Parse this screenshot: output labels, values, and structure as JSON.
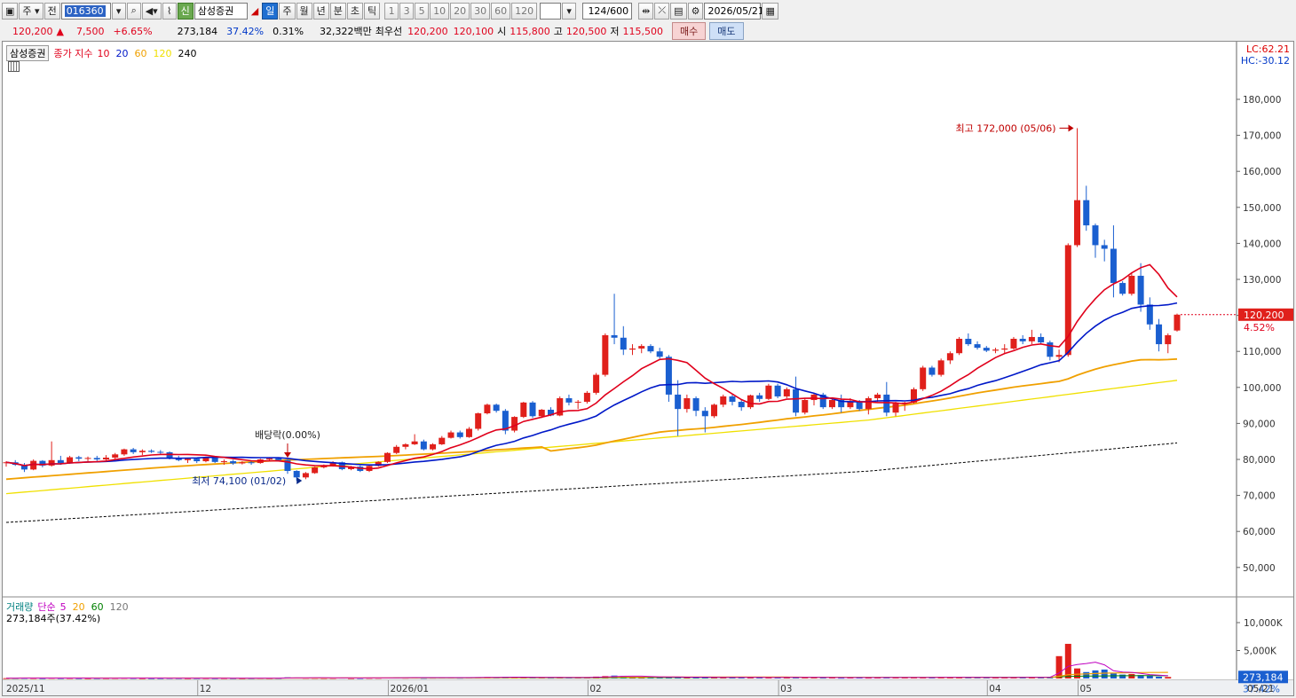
{
  "toolbar": {
    "market": "주",
    "prev_label": "전",
    "code": "016360",
    "stock_name": "삼성증권",
    "badge": "신",
    "periods": [
      "일",
      "주",
      "월",
      "년",
      "분",
      "초",
      "틱"
    ],
    "intervals": [
      "1",
      "3",
      "5",
      "10",
      "20",
      "30",
      "60",
      "120"
    ],
    "count": "124",
    "total": "/600",
    "date": "2026/05/21"
  },
  "quote": {
    "price": "120,200",
    "arrow": "▲",
    "change": "7,500",
    "change_pct": "+6.65%",
    "volume": "273,184",
    "turnover_pct": "37.42%",
    "ratio": "0.31%",
    "amount": "32,322백만",
    "best_label": "최우선",
    "best_ask": "120,200",
    "best_bid": "120,100",
    "open_label": "시",
    "open": "115,800",
    "high_label": "고",
    "high": "120,500",
    "low_label": "저",
    "low": "115,500",
    "buy_label": "매수",
    "sell_label": "매도"
  },
  "price_panel": {
    "title": "삼성증권",
    "legend_prefix": "종가 지수",
    "ma": [
      {
        "label": "10",
        "color": "#e0001b"
      },
      {
        "label": "20",
        "color": "#0018c8"
      },
      {
        "label": "60",
        "color": "#f0a000"
      },
      {
        "label": "120",
        "color": "#f0e000"
      },
      {
        "label": "240",
        "color": "#000000"
      }
    ],
    "lc_label": "LC:62.21",
    "hc_label": "HC:-30.12",
    "y_ticks": [
      "180,000",
      "170,000",
      "160,000",
      "150,000",
      "140,000",
      "130,000",
      "120,000",
      "110,000",
      "100,000",
      "90,000",
      "80,000",
      "70,000",
      "60,000",
      "50,000"
    ],
    "current_price": "120,200",
    "current_pct": "4.52%",
    "high_note": "최고 172,000 (05/06)",
    "low_note": "최저 74,100 (01/02)",
    "dividend_note": "배당락(0.00%)"
  },
  "volume_panel": {
    "title": "거래량",
    "legend_prefix": "단순",
    "ma": [
      {
        "label": "5",
        "color": "#c000c0"
      },
      {
        "label": "20",
        "color": "#f0a000"
      },
      {
        "label": "60",
        "color": "#008000"
      },
      {
        "label": "120",
        "color": "#777777"
      }
    ],
    "value_text": "273,184주(37.42%)",
    "y_ticks": [
      "10,000K",
      "5,000K"
    ],
    "current_value": "273,184",
    "current_pct": "37.42%"
  },
  "x_axis": [
    "2025/11",
    "12",
    "2026/01",
    "02",
    "03",
    "04",
    "05",
    "05/21"
  ],
  "chart_data": {
    "type": "candlestick",
    "ylim": [
      45000,
      185000
    ],
    "x_labels": [
      "2025/11",
      "12",
      "2026/01",
      "02",
      "03",
      "04",
      "05"
    ],
    "candles": [
      [
        79000,
        79500,
        78000,
        79200
      ],
      [
        79200,
        79800,
        78200,
        78500
      ],
      [
        78500,
        79000,
        76500,
        77200
      ],
      [
        77200,
        80000,
        77000,
        79600
      ],
      [
        79600,
        79800,
        77800,
        78300
      ],
      [
        78300,
        85000,
        78000,
        79800
      ],
      [
        79800,
        81000,
        78500,
        79000
      ],
      [
        79000,
        81000,
        78800,
        80600
      ],
      [
        80600,
        81000,
        79500,
        80200
      ],
      [
        80200,
        80800,
        79500,
        80400
      ],
      [
        80400,
        81000,
        79600,
        80000
      ],
      [
        80000,
        81200,
        79700,
        80500
      ],
      [
        80500,
        81800,
        80000,
        81400
      ],
      [
        81400,
        83000,
        81000,
        82800
      ],
      [
        82800,
        83200,
        81500,
        82000
      ],
      [
        82000,
        82800,
        81200,
        82400
      ],
      [
        82400,
        82800,
        81800,
        82100
      ],
      [
        82100,
        82600,
        81500,
        82000
      ],
      [
        82000,
        82200,
        80000,
        80500
      ],
      [
        80500,
        81000,
        79500,
        79800
      ],
      [
        79800,
        80500,
        79000,
        80200
      ],
      [
        80200,
        80400,
        79000,
        79500
      ],
      [
        79500,
        80800,
        79200,
        80400
      ],
      [
        80400,
        80600,
        79000,
        79300
      ],
      [
        79300,
        80000,
        78500,
        79500
      ],
      [
        79500,
        79900,
        78500,
        78900
      ],
      [
        78900,
        79500,
        78600,
        79200
      ],
      [
        79200,
        79700,
        78500,
        79000
      ],
      [
        79000,
        80200,
        78800,
        80000
      ],
      [
        80000,
        80500,
        79800,
        80300
      ],
      [
        80300,
        80500,
        79500,
        79800
      ],
      [
        79800,
        80000,
        76000,
        76800
      ],
      [
        76800,
        77000,
        74100,
        75000
      ],
      [
        75000,
        76500,
        74500,
        76200
      ],
      [
        76200,
        78000,
        76000,
        77800
      ],
      [
        77800,
        78600,
        77500,
        78400
      ],
      [
        78400,
        79500,
        78000,
        79200
      ],
      [
        79200,
        79400,
        77000,
        77300
      ],
      [
        77300,
        78200,
        77000,
        78000
      ],
      [
        78000,
        78300,
        76500,
        76800
      ],
      [
        76800,
        78500,
        76500,
        78200
      ],
      [
        78200,
        79500,
        78000,
        79300
      ],
      [
        79300,
        82000,
        79000,
        81800
      ],
      [
        81800,
        84000,
        81500,
        83500
      ],
      [
        83500,
        84500,
        82800,
        84200
      ],
      [
        84200,
        87000,
        84000,
        85000
      ],
      [
        85000,
        85500,
        82500,
        82800
      ],
      [
        82800,
        84500,
        82500,
        84200
      ],
      [
        84200,
        86500,
        84000,
        86000
      ],
      [
        86000,
        88000,
        85800,
        87500
      ],
      [
        87500,
        88000,
        85800,
        86200
      ],
      [
        86200,
        89000,
        86000,
        88500
      ],
      [
        88500,
        93000,
        88000,
        92800
      ],
      [
        92800,
        95500,
        92500,
        95200
      ],
      [
        95200,
        95500,
        93000,
        93500
      ],
      [
        93500,
        94000,
        87000,
        88000
      ],
      [
        88000,
        92000,
        87500,
        91800
      ],
      [
        91800,
        96000,
        91500,
        95800
      ],
      [
        95800,
        96200,
        91500,
        92000
      ],
      [
        92000,
        94000,
        91500,
        93800
      ],
      [
        93800,
        94500,
        92000,
        92200
      ],
      [
        92200,
        97500,
        92000,
        97000
      ],
      [
        97000,
        98000,
        95000,
        95800
      ],
      [
        95800,
        96500,
        94000,
        96000
      ],
      [
        96000,
        99000,
        95500,
        98500
      ],
      [
        98500,
        104000,
        98000,
        103500
      ],
      [
        103500,
        115000,
        103000,
        114500
      ],
      [
        114500,
        126000,
        112000,
        113800
      ],
      [
        113800,
        117000,
        109000,
        110500
      ],
      [
        110500,
        112000,
        109000,
        110800
      ],
      [
        110800,
        112000,
        109500,
        111500
      ],
      [
        111500,
        112000,
        109500,
        110000
      ],
      [
        110000,
        111000,
        108000,
        108500
      ],
      [
        108500,
        109000,
        96000,
        98000
      ],
      [
        98000,
        102000,
        86500,
        94000
      ],
      [
        94000,
        98000,
        93000,
        97000
      ],
      [
        97000,
        97500,
        92000,
        93500
      ],
      [
        93500,
        94500,
        87500,
        92000
      ],
      [
        92000,
        95500,
        91500,
        95200
      ],
      [
        95200,
        98000,
        94500,
        97500
      ],
      [
        97500,
        98000,
        95000,
        96000
      ],
      [
        96000,
        96500,
        93500,
        94500
      ],
      [
        94500,
        98000,
        94000,
        97800
      ],
      [
        97800,
        98500,
        96000,
        96800
      ],
      [
        96800,
        101000,
        96500,
        100500
      ],
      [
        100500,
        101000,
        97000,
        97500
      ],
      [
        97500,
        100000,
        97000,
        99500
      ],
      [
        99500,
        103000,
        92000,
        93000
      ],
      [
        93000,
        97000,
        92500,
        96500
      ],
      [
        96500,
        98500,
        95000,
        98000
      ],
      [
        98000,
        98500,
        94000,
        94500
      ],
      [
        94500,
        97000,
        94000,
        96500
      ],
      [
        96500,
        98000,
        93000,
        94500
      ],
      [
        94500,
        97000,
        94000,
        96000
      ],
      [
        96000,
        96500,
        93500,
        94000
      ],
      [
        94000,
        97500,
        92500,
        97000
      ],
      [
        97000,
        98500,
        96000,
        98000
      ],
      [
        98000,
        101500,
        92000,
        93000
      ],
      [
        93000,
        96000,
        92000,
        95500
      ],
      [
        95500,
        96000,
        93500,
        95800
      ],
      [
        95800,
        100000,
        95500,
        99500
      ],
      [
        99500,
        106000,
        99000,
        105500
      ],
      [
        105500,
        106000,
        103000,
        103500
      ],
      [
        103500,
        108000,
        103000,
        107500
      ],
      [
        107500,
        110000,
        106500,
        109500
      ],
      [
        109500,
        114000,
        109000,
        113500
      ],
      [
        113500,
        115000,
        111500,
        112000
      ],
      [
        112000,
        112800,
        110500,
        111000
      ],
      [
        111000,
        111500,
        109800,
        110200
      ],
      [
        110200,
        111000,
        109500,
        110500
      ],
      [
        110500,
        112000,
        109500,
        110800
      ],
      [
        110800,
        114000,
        110500,
        113500
      ],
      [
        113500,
        114500,
        112000,
        112800
      ],
      [
        112800,
        116000,
        112000,
        114000
      ],
      [
        114000,
        115000,
        112000,
        112500
      ],
      [
        112500,
        113000,
        107500,
        108500
      ],
      [
        108500,
        110500,
        107000,
        109000
      ],
      [
        109000,
        140000,
        108500,
        139500
      ],
      [
        139500,
        172000,
        139000,
        152000
      ],
      [
        152000,
        156000,
        143500,
        145000
      ],
      [
        145000,
        145500,
        136000,
        139500
      ],
      [
        139500,
        141000,
        135000,
        138500
      ],
      [
        138500,
        145000,
        125000,
        129000
      ],
      [
        129000,
        129500,
        125500,
        126000
      ],
      [
        126000,
        132000,
        125500,
        131000
      ],
      [
        131000,
        134500,
        121000,
        123000
      ],
      [
        123000,
        125000,
        116000,
        117500
      ],
      [
        117500,
        119000,
        110000,
        112000
      ],
      [
        112000,
        115000,
        109500,
        114500
      ],
      [
        115800,
        120500,
        115500,
        120200
      ]
    ],
    "volume_k": [
      60,
      70,
      90,
      80,
      60,
      110,
      70,
      85,
      60,
      55,
      65,
      70,
      90,
      110,
      80,
      60,
      55,
      60,
      80,
      70,
      60,
      65,
      75,
      60,
      70,
      55,
      50,
      60,
      80,
      65,
      70,
      210,
      170,
      120,
      110,
      90,
      100,
      150,
      80,
      90,
      110,
      120,
      160,
      180,
      140,
      190,
      120,
      150,
      170,
      180,
      140,
      170,
      240,
      260,
      200,
      280,
      190,
      230,
      200,
      160,
      150,
      220,
      180,
      160,
      200,
      340,
      430,
      520,
      480,
      300,
      310,
      230,
      200,
      310,
      280,
      200,
      180,
      260,
      230,
      190,
      170,
      200,
      160,
      220,
      160,
      170,
      280,
      180,
      160,
      170,
      150,
      180,
      140,
      160,
      170,
      150,
      180,
      200,
      160,
      180,
      190,
      160,
      210,
      250,
      230,
      200,
      170,
      160,
      180,
      170,
      210,
      180,
      190,
      200,
      220,
      290,
      4000,
      6200,
      1800,
      1150,
      1450,
      1600,
      900,
      700,
      800,
      600,
      500,
      320,
      273
    ],
    "current_volume": "273,184"
  }
}
